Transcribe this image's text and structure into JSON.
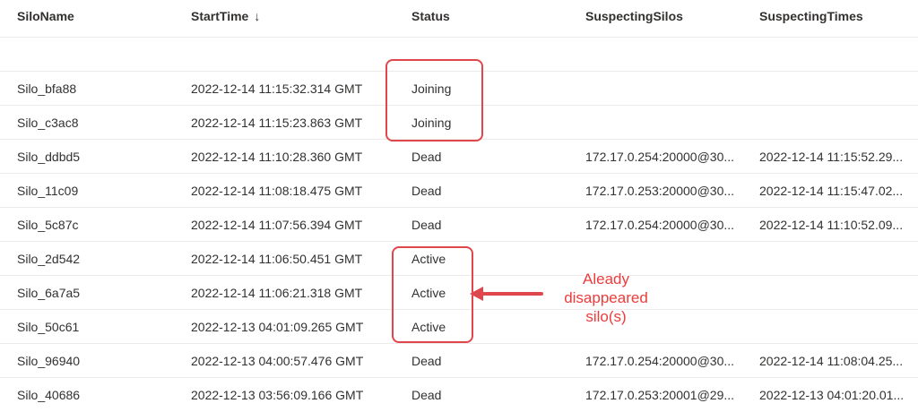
{
  "table": {
    "headers": {
      "silo_name": "SiloName",
      "start_time": "StartTime",
      "start_time_sort_icon": "↓",
      "status": "Status",
      "suspecting_silos": "SuspectingSilos",
      "suspecting_times": "SuspectingTimes"
    },
    "rows": [
      {
        "silo_name": "Silo_bfa88",
        "start_time": "2022-12-14 11:15:32.314 GMT",
        "status": "Joining",
        "suspecting_silos": "",
        "suspecting_times": ""
      },
      {
        "silo_name": "Silo_c3ac8",
        "start_time": "2022-12-14 11:15:23.863 GMT",
        "status": "Joining",
        "suspecting_silos": "",
        "suspecting_times": ""
      },
      {
        "silo_name": "Silo_ddbd5",
        "start_time": "2022-12-14 11:10:28.360 GMT",
        "status": "Dead",
        "suspecting_silos": "172.17.0.254:20000@30...",
        "suspecting_times": "2022-12-14 11:15:52.29..."
      },
      {
        "silo_name": "Silo_11c09",
        "start_time": "2022-12-14 11:08:18.475 GMT",
        "status": "Dead",
        "suspecting_silos": "172.17.0.253:20000@30...",
        "suspecting_times": "2022-12-14 11:15:47.02..."
      },
      {
        "silo_name": "Silo_5c87c",
        "start_time": "2022-12-14 11:07:56.394 GMT",
        "status": "Dead",
        "suspecting_silos": "172.17.0.254:20000@30...",
        "suspecting_times": "2022-12-14 11:10:52.09..."
      },
      {
        "silo_name": "Silo_2d542",
        "start_time": "2022-12-14 11:06:50.451 GMT",
        "status": "Active",
        "suspecting_silos": "",
        "suspecting_times": ""
      },
      {
        "silo_name": "Silo_6a7a5",
        "start_time": "2022-12-14 11:06:21.318 GMT",
        "status": "Active",
        "suspecting_silos": "",
        "suspecting_times": ""
      },
      {
        "silo_name": "Silo_50c61",
        "start_time": "2022-12-13 04:01:09.265 GMT",
        "status": "Active",
        "suspecting_silos": "",
        "suspecting_times": ""
      },
      {
        "silo_name": "Silo_96940",
        "start_time": "2022-12-13 04:00:57.476 GMT",
        "status": "Dead",
        "suspecting_silos": "172.17.0.254:20000@30...",
        "suspecting_times": "2022-12-14 11:08:04.25..."
      },
      {
        "silo_name": "Silo_40686",
        "start_time": "2022-12-13 03:56:09.166 GMT",
        "status": "Dead",
        "suspecting_silos": "172.17.0.253:20001@29...",
        "suspecting_times": "2022-12-13 04:01:20.01..."
      }
    ]
  },
  "annotation": {
    "lines": [
      "Aleady",
      "disappeared",
      "silo(s)"
    ],
    "color": "#ee3b3b"
  },
  "highlight_color": "#e0474c"
}
